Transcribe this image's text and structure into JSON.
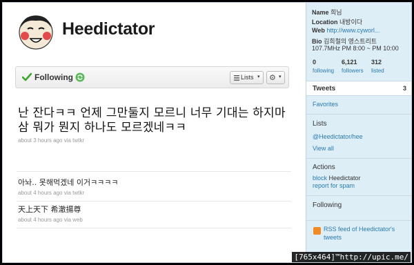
{
  "profile": {
    "name": "Heedictator"
  },
  "following_bar": {
    "label": "Following",
    "lists_label": "Lists",
    "dropdown_arrow": "▾"
  },
  "tweets": [
    {
      "text": "난 잔다ㅋㅋ 언제 그만둘지 모르니 너무 기대는 하지마삼 뭐가 뭔지 하나도 모르겠네ㅋㅋ",
      "meta": "about 3 hours ago via twtkr"
    },
    {
      "text": "아놔.. 못해먹겠네 이거ㅋㅋㅋㅋ",
      "meta": "about 4 hours ago via twtkr"
    },
    {
      "text": "天上天下 希澈揚尊",
      "meta": "about 4 hours ago via web"
    }
  ],
  "sidebar": {
    "name_label": "Name",
    "name_value": "희님",
    "location_label": "Location",
    "location_value": "내방이다",
    "web_label": "Web",
    "web_value": "http://www.cyworl...",
    "bio_label": "Bio",
    "bio_value_1": "김희철의 영스트리트",
    "bio_value_2": "107.7MHz PM 8:00 ~ PM 10:00",
    "stats": [
      {
        "num": "0",
        "label": "following"
      },
      {
        "num": "6,121",
        "label": "followers"
      },
      {
        "num": "312",
        "label": "listed"
      }
    ],
    "tweets_label": "Tweets",
    "tweets_count": "3",
    "favorites": "Favorites",
    "lists_head": "Lists",
    "lists_link": "@Heedictator/hee",
    "view_all": "View all",
    "actions_head": "Actions",
    "block_link": "block",
    "block_name": "Heedictator",
    "report_spam": "report for spam",
    "following_head": "Following",
    "rss_line1": "RSS feed of Heedictator's",
    "rss_line2": "tweets"
  },
  "watermark": "[765x464]™http://upic.me/",
  "colors": {
    "link": "#2a7ab0",
    "sidebar_bg": "#ddeef6",
    "check": "#3aa52a",
    "refresh": "#5cb85c"
  }
}
